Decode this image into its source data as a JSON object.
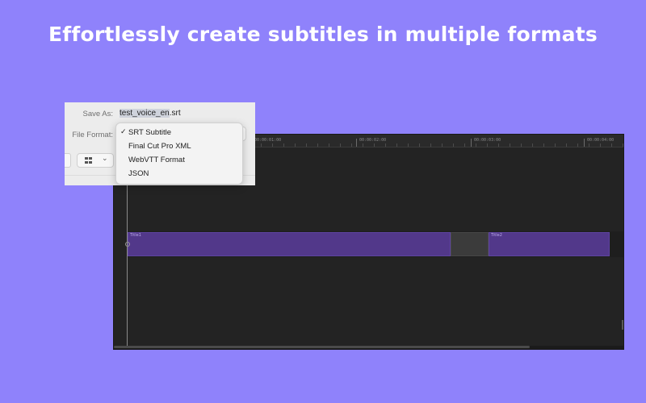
{
  "headline": "Effortlessly create subtitles in multiple formats",
  "dialog": {
    "save_as_label": "Save As:",
    "filename_base": "test_voice_en",
    "filename_ext": ".srt",
    "file_format_label": "File Format:"
  },
  "format_menu": {
    "selected": "SRT Subtitle",
    "items": [
      "SRT Subtitle",
      "Final Cut Pro XML",
      "WebVTT Format",
      "JSON"
    ]
  },
  "timeline": {
    "ruler_labels": [
      "00:00:01:00",
      "00:00:02:00",
      "00:00:03:00",
      "00:00:04:00"
    ],
    "clips": [
      "Title1",
      "Title2"
    ]
  },
  "colors": {
    "background": "#8f82fb",
    "clip": "#52388a",
    "timeline": "#232323"
  }
}
